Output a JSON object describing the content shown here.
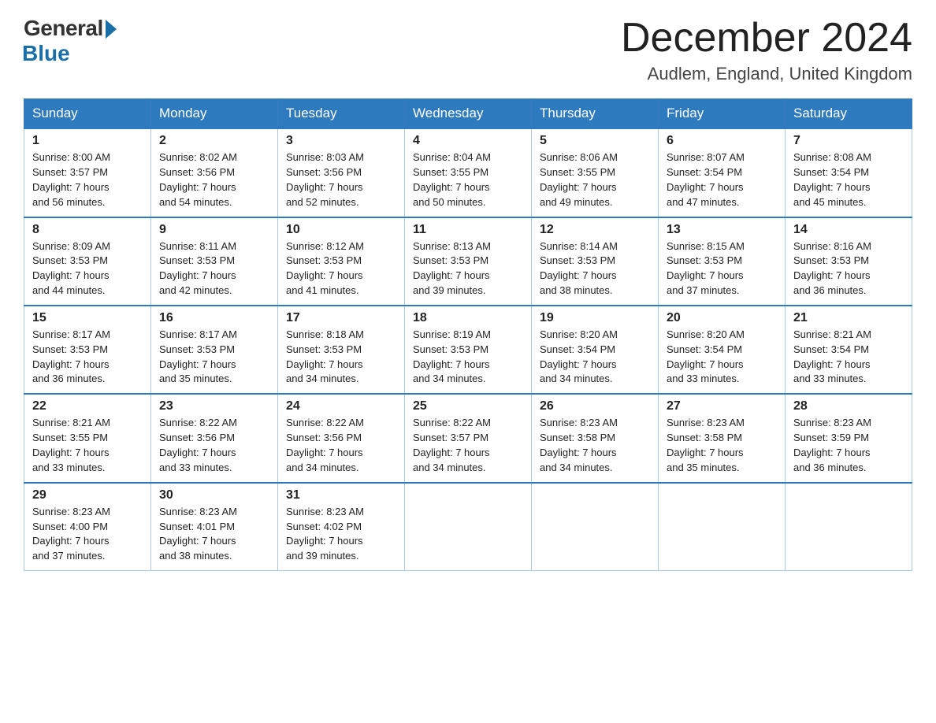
{
  "logo": {
    "general": "General",
    "blue": "Blue"
  },
  "header": {
    "month_year": "December 2024",
    "location": "Audlem, England, United Kingdom"
  },
  "weekdays": [
    "Sunday",
    "Monday",
    "Tuesday",
    "Wednesday",
    "Thursday",
    "Friday",
    "Saturday"
  ],
  "weeks": [
    [
      {
        "day": "1",
        "sunrise": "8:00 AM",
        "sunset": "3:57 PM",
        "daylight": "7 hours and 56 minutes."
      },
      {
        "day": "2",
        "sunrise": "8:02 AM",
        "sunset": "3:56 PM",
        "daylight": "7 hours and 54 minutes."
      },
      {
        "day": "3",
        "sunrise": "8:03 AM",
        "sunset": "3:56 PM",
        "daylight": "7 hours and 52 minutes."
      },
      {
        "day": "4",
        "sunrise": "8:04 AM",
        "sunset": "3:55 PM",
        "daylight": "7 hours and 50 minutes."
      },
      {
        "day": "5",
        "sunrise": "8:06 AM",
        "sunset": "3:55 PM",
        "daylight": "7 hours and 49 minutes."
      },
      {
        "day": "6",
        "sunrise": "8:07 AM",
        "sunset": "3:54 PM",
        "daylight": "7 hours and 47 minutes."
      },
      {
        "day": "7",
        "sunrise": "8:08 AM",
        "sunset": "3:54 PM",
        "daylight": "7 hours and 45 minutes."
      }
    ],
    [
      {
        "day": "8",
        "sunrise": "8:09 AM",
        "sunset": "3:53 PM",
        "daylight": "7 hours and 44 minutes."
      },
      {
        "day": "9",
        "sunrise": "8:11 AM",
        "sunset": "3:53 PM",
        "daylight": "7 hours and 42 minutes."
      },
      {
        "day": "10",
        "sunrise": "8:12 AM",
        "sunset": "3:53 PM",
        "daylight": "7 hours and 41 minutes."
      },
      {
        "day": "11",
        "sunrise": "8:13 AM",
        "sunset": "3:53 PM",
        "daylight": "7 hours and 39 minutes."
      },
      {
        "day": "12",
        "sunrise": "8:14 AM",
        "sunset": "3:53 PM",
        "daylight": "7 hours and 38 minutes."
      },
      {
        "day": "13",
        "sunrise": "8:15 AM",
        "sunset": "3:53 PM",
        "daylight": "7 hours and 37 minutes."
      },
      {
        "day": "14",
        "sunrise": "8:16 AM",
        "sunset": "3:53 PM",
        "daylight": "7 hours and 36 minutes."
      }
    ],
    [
      {
        "day": "15",
        "sunrise": "8:17 AM",
        "sunset": "3:53 PM",
        "daylight": "7 hours and 36 minutes."
      },
      {
        "day": "16",
        "sunrise": "8:17 AM",
        "sunset": "3:53 PM",
        "daylight": "7 hours and 35 minutes."
      },
      {
        "day": "17",
        "sunrise": "8:18 AM",
        "sunset": "3:53 PM",
        "daylight": "7 hours and 34 minutes."
      },
      {
        "day": "18",
        "sunrise": "8:19 AM",
        "sunset": "3:53 PM",
        "daylight": "7 hours and 34 minutes."
      },
      {
        "day": "19",
        "sunrise": "8:20 AM",
        "sunset": "3:54 PM",
        "daylight": "7 hours and 34 minutes."
      },
      {
        "day": "20",
        "sunrise": "8:20 AM",
        "sunset": "3:54 PM",
        "daylight": "7 hours and 33 minutes."
      },
      {
        "day": "21",
        "sunrise": "8:21 AM",
        "sunset": "3:54 PM",
        "daylight": "7 hours and 33 minutes."
      }
    ],
    [
      {
        "day": "22",
        "sunrise": "8:21 AM",
        "sunset": "3:55 PM",
        "daylight": "7 hours and 33 minutes."
      },
      {
        "day": "23",
        "sunrise": "8:22 AM",
        "sunset": "3:56 PM",
        "daylight": "7 hours and 33 minutes."
      },
      {
        "day": "24",
        "sunrise": "8:22 AM",
        "sunset": "3:56 PM",
        "daylight": "7 hours and 34 minutes."
      },
      {
        "day": "25",
        "sunrise": "8:22 AM",
        "sunset": "3:57 PM",
        "daylight": "7 hours and 34 minutes."
      },
      {
        "day": "26",
        "sunrise": "8:23 AM",
        "sunset": "3:58 PM",
        "daylight": "7 hours and 34 minutes."
      },
      {
        "day": "27",
        "sunrise": "8:23 AM",
        "sunset": "3:58 PM",
        "daylight": "7 hours and 35 minutes."
      },
      {
        "day": "28",
        "sunrise": "8:23 AM",
        "sunset": "3:59 PM",
        "daylight": "7 hours and 36 minutes."
      }
    ],
    [
      {
        "day": "29",
        "sunrise": "8:23 AM",
        "sunset": "4:00 PM",
        "daylight": "7 hours and 37 minutes."
      },
      {
        "day": "30",
        "sunrise": "8:23 AM",
        "sunset": "4:01 PM",
        "daylight": "7 hours and 38 minutes."
      },
      {
        "day": "31",
        "sunrise": "8:23 AM",
        "sunset": "4:02 PM",
        "daylight": "7 hours and 39 minutes."
      },
      null,
      null,
      null,
      null
    ]
  ],
  "labels": {
    "sunrise": "Sunrise: ",
    "sunset": "Sunset: ",
    "daylight": "Daylight: "
  }
}
